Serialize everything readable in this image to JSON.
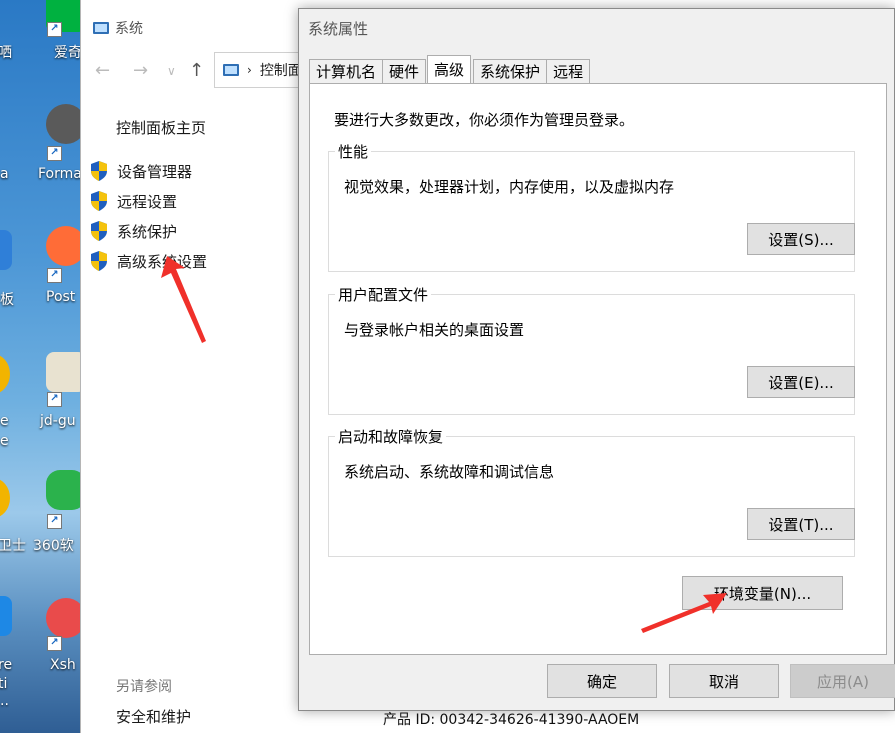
{
  "desktop": {
    "icons": [
      {
        "label": "爱奇",
        "color": "#00b140"
      },
      {
        "label": "Forma",
        "color": "#5a5a5a"
      },
      {
        "label": "Post",
        "color": "#ff6c37"
      },
      {
        "label": "jd-gu",
        "color": "#e8e2d0"
      },
      {
        "label": "360软",
        "color": "#2bb24c"
      },
      {
        "label": "Xsh",
        "color": "#e94b4b"
      }
    ],
    "edge_labels": [
      "哂",
      "a",
      "板",
      "e",
      "e",
      "卫士",
      "re",
      "ti",
      ".."
    ]
  },
  "system_window": {
    "title": "系统",
    "address": "控制面",
    "home_link": "控制面板主页",
    "side_links": [
      "设备管理器",
      "远程设置",
      "系统保护",
      "高级系统设置"
    ],
    "see_also": "另请参阅",
    "security_link": "安全和维护",
    "product_id": "产品 ID: 00342-34626-41390-AAOEM"
  },
  "dialog": {
    "title": "系统属性",
    "tabs": [
      "计算机名",
      "硬件",
      "高级",
      "系统保护",
      "远程"
    ],
    "active_tab": "高级",
    "admin_note": "要进行大多数更改，你必须作为管理员登录。",
    "groups": [
      {
        "title": "性能",
        "desc": "视觉效果，处理器计划，内存使用，以及虚拟内存",
        "button": "设置(S)..."
      },
      {
        "title": "用户配置文件",
        "desc": "与登录帐户相关的桌面设置",
        "button": "设置(E)..."
      },
      {
        "title": "启动和故障恢复",
        "desc": "系统启动、系统故障和调试信息",
        "button": "设置(T)..."
      }
    ],
    "env_button": "环境变量(N)...",
    "ok": "确定",
    "cancel": "取消",
    "apply": "应用(A)"
  },
  "colors": {
    "annotation_arrow": "#f0302a",
    "shield_blue": "#1f5fbf",
    "shield_yellow": "#f4c20d"
  }
}
